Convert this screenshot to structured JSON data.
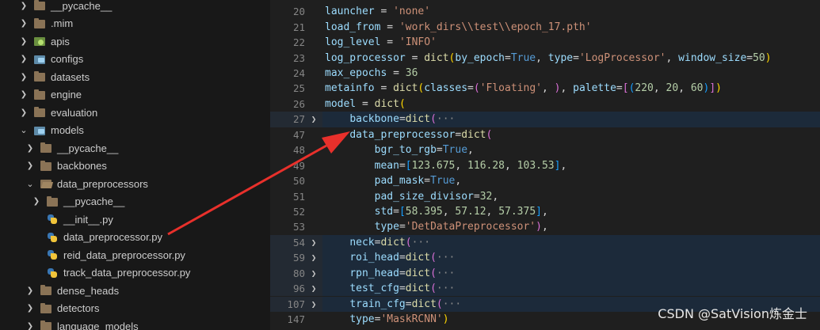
{
  "explorer": {
    "items": [
      {
        "label": "__pycache__",
        "icon": "folder-icon",
        "chevron": "right",
        "indent": 0
      },
      {
        "label": ".mim",
        "icon": "folder-icon",
        "chevron": "right",
        "indent": 0
      },
      {
        "label": "apis",
        "icon": "api-folder-icon",
        "chevron": "right",
        "indent": 0
      },
      {
        "label": "configs",
        "icon": "config-folder-icon",
        "chevron": "right",
        "indent": 0
      },
      {
        "label": "datasets",
        "icon": "folder-icon",
        "chevron": "right",
        "indent": 0
      },
      {
        "label": "engine",
        "icon": "folder-icon",
        "chevron": "right",
        "indent": 0
      },
      {
        "label": "evaluation",
        "icon": "folder-icon",
        "chevron": "right",
        "indent": 0
      },
      {
        "label": "models",
        "icon": "models-folder-icon",
        "chevron": "down",
        "indent": 0
      },
      {
        "label": "__pycache__",
        "icon": "folder-icon",
        "chevron": "right",
        "indent": 1
      },
      {
        "label": "backbones",
        "icon": "folder-icon",
        "chevron": "right",
        "indent": 1
      },
      {
        "label": "data_preprocessors",
        "icon": "folder-open-icon",
        "chevron": "down",
        "indent": 1
      },
      {
        "label": "__pycache__",
        "icon": "folder-icon",
        "chevron": "right",
        "indent": 2
      },
      {
        "label": "__init__.py",
        "icon": "python-file-icon",
        "chevron": "",
        "indent": 2
      },
      {
        "label": "data_preprocessor.py",
        "icon": "python-file-icon",
        "chevron": "",
        "indent": 2
      },
      {
        "label": "reid_data_preprocessor.py",
        "icon": "python-file-icon",
        "chevron": "",
        "indent": 2
      },
      {
        "label": "track_data_preprocessor.py",
        "icon": "python-file-icon",
        "chevron": "",
        "indent": 2
      },
      {
        "label": "dense_heads",
        "icon": "folder-icon",
        "chevron": "right",
        "indent": 1
      },
      {
        "label": "detectors",
        "icon": "folder-icon",
        "chevron": "right",
        "indent": 1
      },
      {
        "label": "language_models",
        "icon": "folder-icon",
        "chevron": "right",
        "indent": 1
      }
    ]
  },
  "editor": {
    "lines": [
      {
        "num": "20",
        "fold": false,
        "hl": false,
        "indent": 0,
        "tokens": [
          [
            "var",
            "launcher"
          ],
          [
            "op",
            " = "
          ],
          [
            "str",
            "'none'"
          ]
        ]
      },
      {
        "num": "21",
        "fold": false,
        "hl": false,
        "indent": 0,
        "tokens": [
          [
            "var",
            "load_from"
          ],
          [
            "op",
            " = "
          ],
          [
            "str",
            "'work_dirs\\\\test\\\\epoch_17.pth'"
          ]
        ]
      },
      {
        "num": "22",
        "fold": false,
        "hl": false,
        "indent": 0,
        "tokens": [
          [
            "var",
            "log_level"
          ],
          [
            "op",
            " = "
          ],
          [
            "str",
            "'INFO'"
          ]
        ]
      },
      {
        "num": "23",
        "fold": false,
        "hl": false,
        "indent": 0,
        "tokens": [
          [
            "var",
            "log_processor"
          ],
          [
            "op",
            " = "
          ],
          [
            "func",
            "dict"
          ],
          [
            "br1",
            "("
          ],
          [
            "var",
            "by_epoch"
          ],
          [
            "op",
            "="
          ],
          [
            "kw",
            "True"
          ],
          [
            "op",
            ", "
          ],
          [
            "var",
            "type"
          ],
          [
            "op",
            "="
          ],
          [
            "str",
            "'LogProcessor'"
          ],
          [
            "op",
            ", "
          ],
          [
            "var",
            "window_size"
          ],
          [
            "op",
            "="
          ],
          [
            "num",
            "50"
          ],
          [
            "br1",
            ")"
          ]
        ]
      },
      {
        "num": "24",
        "fold": false,
        "hl": false,
        "indent": 0,
        "tokens": [
          [
            "var",
            "max_epochs"
          ],
          [
            "op",
            " = "
          ],
          [
            "num",
            "36"
          ]
        ]
      },
      {
        "num": "25",
        "fold": false,
        "hl": false,
        "indent": 0,
        "tokens": [
          [
            "var",
            "metainfo"
          ],
          [
            "op",
            " = "
          ],
          [
            "func",
            "dict"
          ],
          [
            "br1",
            "("
          ],
          [
            "var",
            "classes"
          ],
          [
            "op",
            "="
          ],
          [
            "br2",
            "("
          ],
          [
            "str",
            "'Floating'"
          ],
          [
            "op",
            ", "
          ],
          [
            "br2",
            ")"
          ],
          [
            "op",
            ", "
          ],
          [
            "var",
            "palette"
          ],
          [
            "op",
            "="
          ],
          [
            "br2",
            "["
          ],
          [
            "br3",
            "("
          ],
          [
            "num",
            "220"
          ],
          [
            "op",
            ", "
          ],
          [
            "num",
            "20"
          ],
          [
            "op",
            ", "
          ],
          [
            "num",
            "60"
          ],
          [
            "br3",
            ")"
          ],
          [
            "br2",
            "]"
          ],
          [
            "br1",
            ")"
          ]
        ]
      },
      {
        "num": "26",
        "fold": false,
        "hl": false,
        "indent": 0,
        "tokens": [
          [
            "var",
            "model"
          ],
          [
            "op",
            " = "
          ],
          [
            "func",
            "dict"
          ],
          [
            "br1",
            "("
          ]
        ]
      },
      {
        "num": "27",
        "fold": true,
        "hl": true,
        "indent": 1,
        "tokens": [
          [
            "var",
            "backbone"
          ],
          [
            "op",
            "="
          ],
          [
            "func",
            "dict"
          ],
          [
            "br2",
            "("
          ],
          [
            "ell",
            "···"
          ]
        ]
      },
      {
        "num": "47",
        "fold": false,
        "hl": false,
        "indent": 1,
        "tokens": [
          [
            "var",
            "data_preprocessor"
          ],
          [
            "op",
            "="
          ],
          [
            "func",
            "dict"
          ],
          [
            "br2",
            "("
          ]
        ]
      },
      {
        "num": "48",
        "fold": false,
        "hl": false,
        "indent": 2,
        "tokens": [
          [
            "var",
            "bgr_to_rgb"
          ],
          [
            "op",
            "="
          ],
          [
            "kw",
            "True"
          ],
          [
            "op",
            ","
          ]
        ]
      },
      {
        "num": "49",
        "fold": false,
        "hl": false,
        "indent": 2,
        "tokens": [
          [
            "var",
            "mean"
          ],
          [
            "op",
            "="
          ],
          [
            "br3",
            "["
          ],
          [
            "num",
            "123.675"
          ],
          [
            "op",
            ", "
          ],
          [
            "num",
            "116.28"
          ],
          [
            "op",
            ", "
          ],
          [
            "num",
            "103.53"
          ],
          [
            "br3",
            "]"
          ],
          [
            "op",
            ","
          ]
        ]
      },
      {
        "num": "50",
        "fold": false,
        "hl": false,
        "indent": 2,
        "tokens": [
          [
            "var",
            "pad_mask"
          ],
          [
            "op",
            "="
          ],
          [
            "kw",
            "True"
          ],
          [
            "op",
            ","
          ]
        ]
      },
      {
        "num": "51",
        "fold": false,
        "hl": false,
        "indent": 2,
        "tokens": [
          [
            "var",
            "pad_size_divisor"
          ],
          [
            "op",
            "="
          ],
          [
            "num",
            "32"
          ],
          [
            "op",
            ","
          ]
        ]
      },
      {
        "num": "52",
        "fold": false,
        "hl": false,
        "indent": 2,
        "tokens": [
          [
            "var",
            "std"
          ],
          [
            "op",
            "="
          ],
          [
            "br3",
            "["
          ],
          [
            "num",
            "58.395"
          ],
          [
            "op",
            ", "
          ],
          [
            "num",
            "57.12"
          ],
          [
            "op",
            ", "
          ],
          [
            "num",
            "57.375"
          ],
          [
            "br3",
            "]"
          ],
          [
            "op",
            ","
          ]
        ]
      },
      {
        "num": "53",
        "fold": false,
        "hl": false,
        "indent": 2,
        "tokens": [
          [
            "var",
            "type"
          ],
          [
            "op",
            "="
          ],
          [
            "str",
            "'DetDataPreprocessor'"
          ],
          [
            "br2",
            ")"
          ],
          [
            "op",
            ","
          ]
        ]
      },
      {
        "num": "54",
        "fold": true,
        "hl": true,
        "indent": 1,
        "tokens": [
          [
            "var",
            "neck"
          ],
          [
            "op",
            "="
          ],
          [
            "func",
            "dict"
          ],
          [
            "br2",
            "("
          ],
          [
            "ell",
            "···"
          ]
        ]
      },
      {
        "num": "59",
        "fold": true,
        "hl": true,
        "indent": 1,
        "tokens": [
          [
            "var",
            "roi_head"
          ],
          [
            "op",
            "="
          ],
          [
            "func",
            "dict"
          ],
          [
            "br2",
            "("
          ],
          [
            "ell",
            "···"
          ]
        ]
      },
      {
        "num": "80",
        "fold": true,
        "hl": true,
        "indent": 1,
        "tokens": [
          [
            "var",
            "rpn_head"
          ],
          [
            "op",
            "="
          ],
          [
            "func",
            "dict"
          ],
          [
            "br2",
            "("
          ],
          [
            "ell",
            "···"
          ]
        ]
      },
      {
        "num": "96",
        "fold": true,
        "hl": true,
        "indent": 1,
        "tokens": [
          [
            "var",
            "test_cfg"
          ],
          [
            "op",
            "="
          ],
          [
            "func",
            "dict"
          ],
          [
            "br2",
            "("
          ],
          [
            "ell",
            "···"
          ]
        ]
      },
      {
        "num": "107",
        "fold": true,
        "hl": true,
        "indent": 1,
        "tokens": [
          [
            "var",
            "train_cfg"
          ],
          [
            "op",
            "="
          ],
          [
            "func",
            "dict"
          ],
          [
            "br2",
            "("
          ],
          [
            "ell",
            "···"
          ]
        ]
      },
      {
        "num": "147",
        "fold": false,
        "hl": false,
        "indent": 1,
        "tokens": [
          [
            "var",
            "type"
          ],
          [
            "op",
            "="
          ],
          [
            "str",
            "'MaskRCNN'"
          ],
          [
            "br1",
            ")"
          ]
        ]
      }
    ]
  },
  "annotation": {
    "arrow_color": "#e8302b"
  },
  "watermark": "CSDN @SatVision炼金士"
}
